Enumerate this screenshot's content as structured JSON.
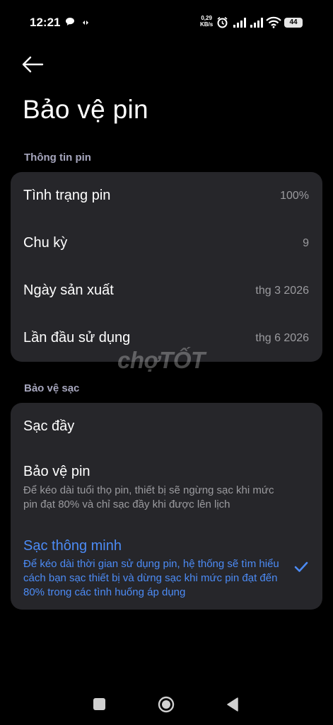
{
  "status_bar": {
    "time": "12:21",
    "net_speed_value": "0,29",
    "net_speed_unit": "KB/s",
    "battery": "44"
  },
  "header": {
    "title": "Bảo vệ pin"
  },
  "battery_info": {
    "section_label": "Thông tin pin",
    "rows": [
      {
        "label": "Tình trạng pin",
        "value": "100%"
      },
      {
        "label": "Chu kỳ",
        "value": "9"
      },
      {
        "label": "Ngày sản xuất",
        "value": "thg 3 2026"
      },
      {
        "label": "Lần đầu sử dụng",
        "value": "thg 6 2026"
      }
    ]
  },
  "charge_protection": {
    "section_label": "Bảo vệ sạc",
    "options": [
      {
        "title": "Sạc đầy",
        "desc": "",
        "selected": false
      },
      {
        "title": "Bảo vệ pin",
        "desc": "Để kéo dài tuổi thọ pin, thiết bị sẽ ngừng sạc khi mức pin đạt 80% và chỉ sạc đầy khi được lên lịch",
        "selected": false
      },
      {
        "title": "Sạc thông minh",
        "desc": "Để kéo dài thời gian sử dụng pin, hệ thống sẽ tìm hiểu cách bạn sạc thiết bị và dừng sạc khi mức pin đạt đến 80% trong các tình huống áp dụng",
        "selected": true
      }
    ]
  },
  "watermark": "chợTỐT",
  "colors": {
    "accent": "#4c8bf5",
    "card_bg": "#26262a",
    "section_label": "#a6a6bd",
    "secondary_text": "#9b9b9f"
  }
}
